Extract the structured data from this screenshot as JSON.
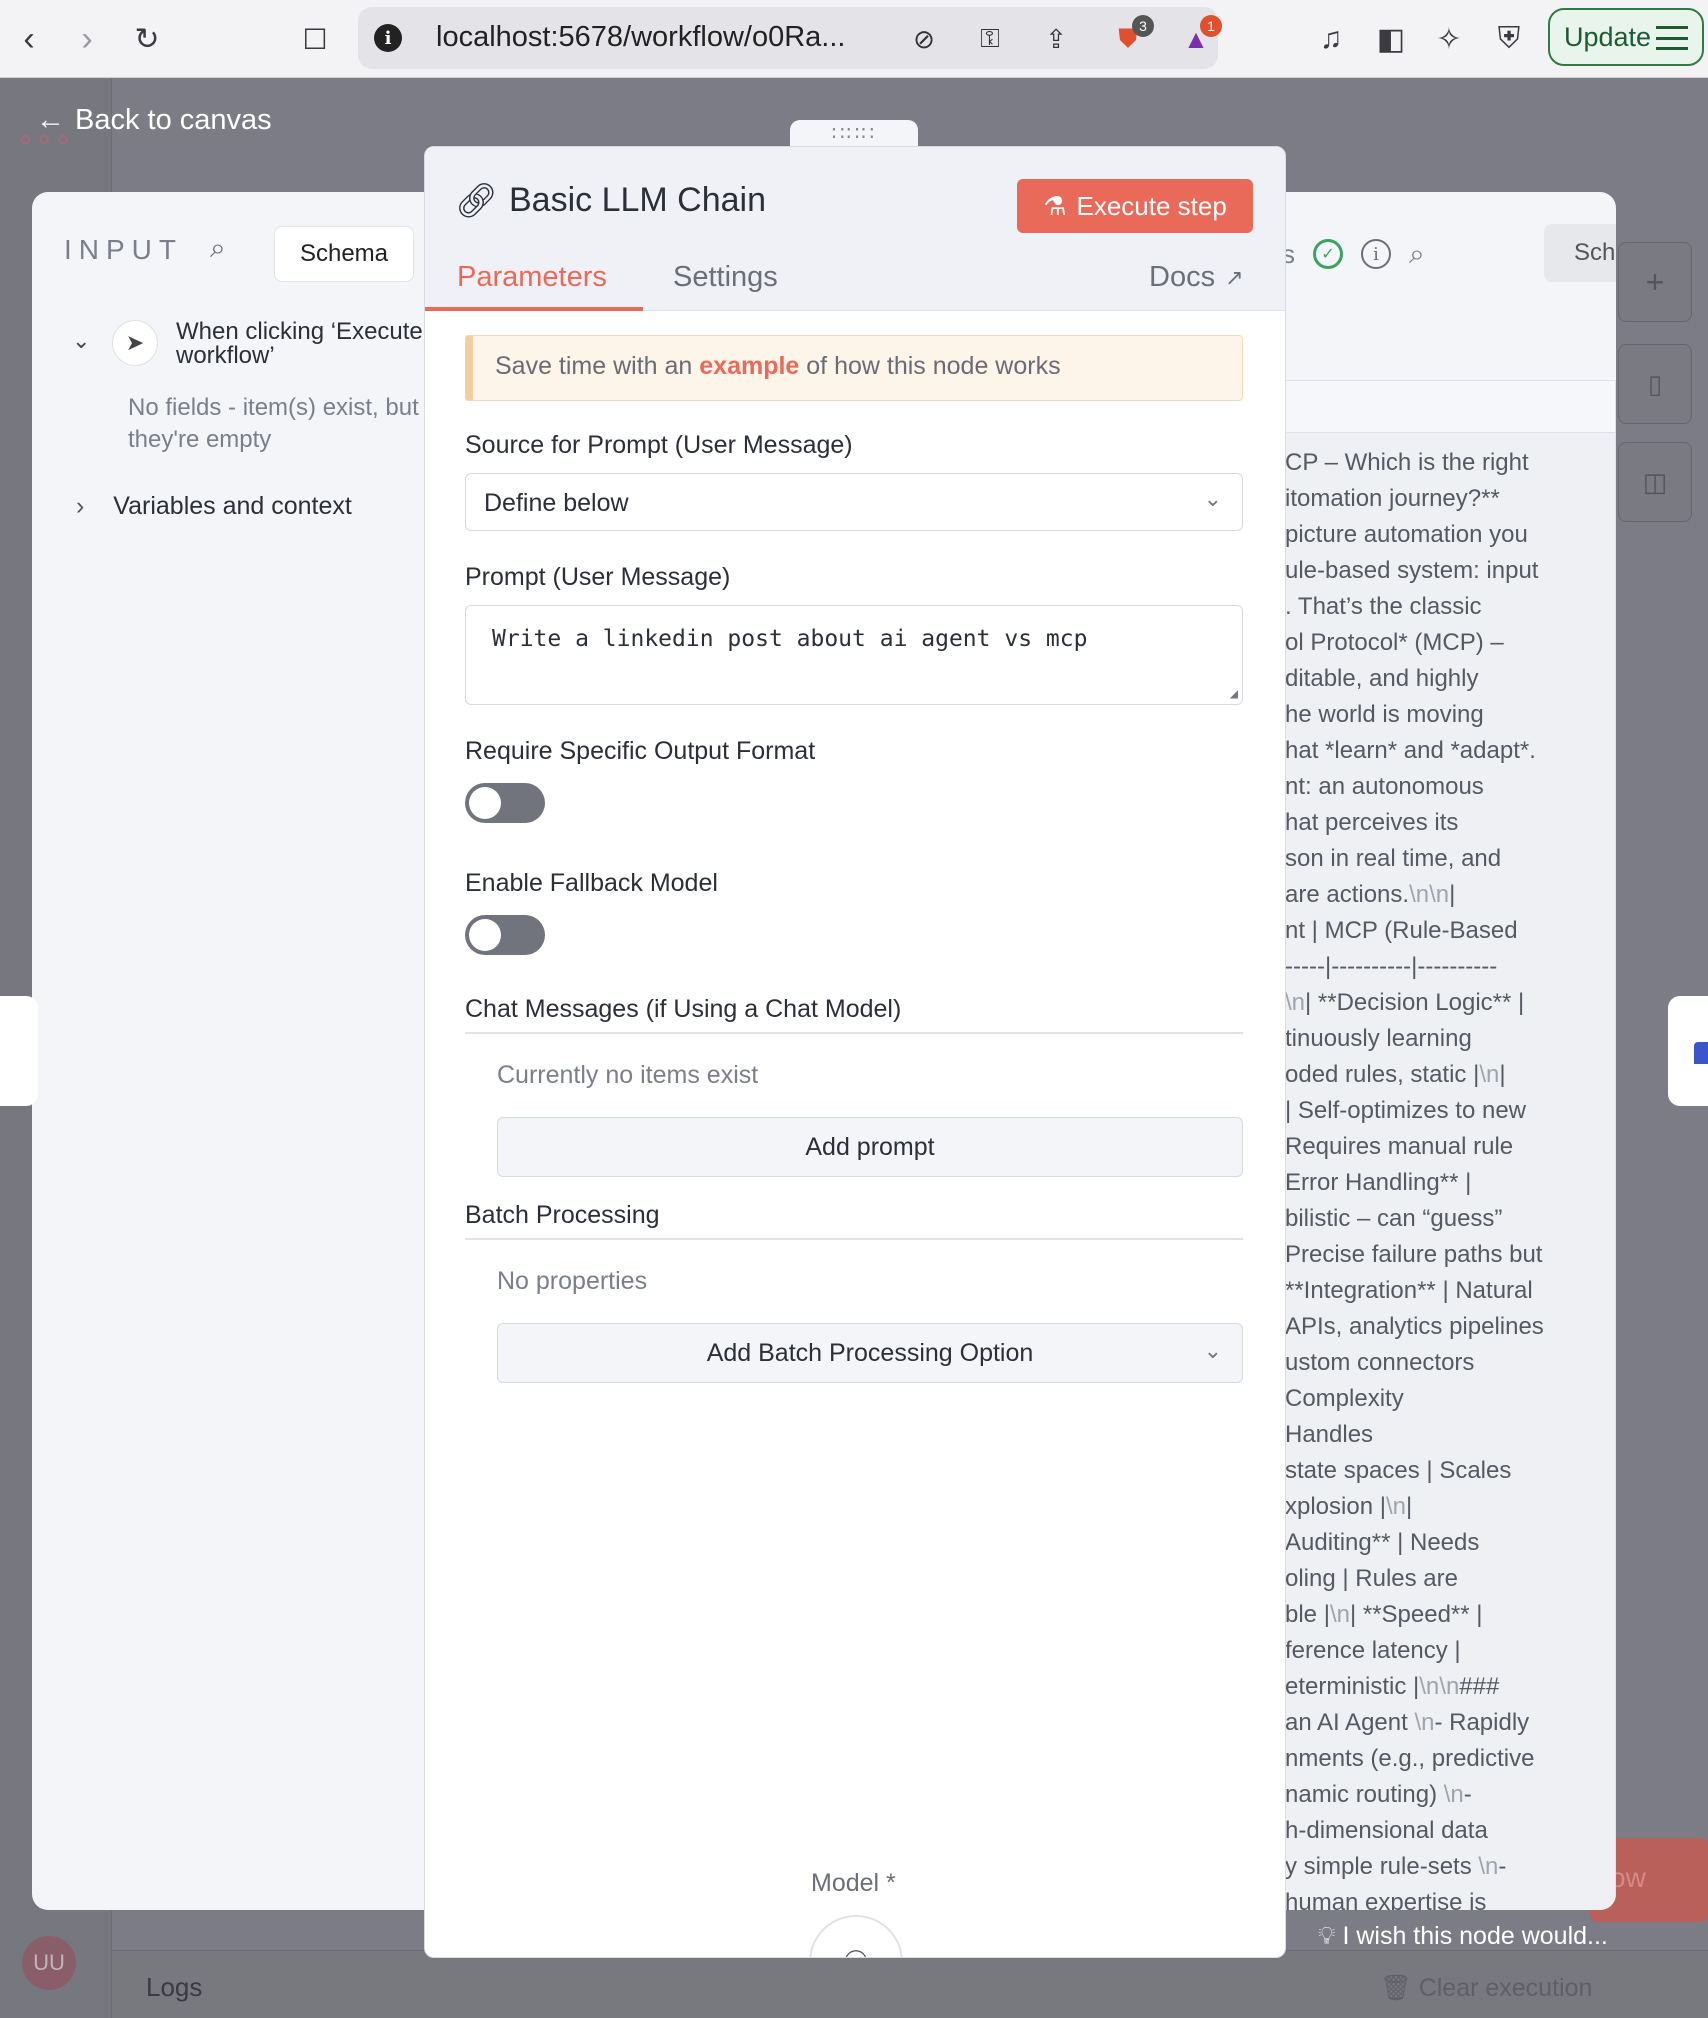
{
  "browser": {
    "url": "localhost:5678/workflow/o0Ra...",
    "brave_badge": "3",
    "rewards_badge": "1",
    "update_label": "Update"
  },
  "app": {
    "back_label": "Back to canvas",
    "avatar_initials": "UU",
    "logs_label": "Logs",
    "clear_execution_label": "Clear execution",
    "feedback_text": "I wish this node would...",
    "bg_button_text": "ow"
  },
  "input_panel": {
    "title": "INPUT",
    "schema_tab": "Schema",
    "trigger_name": "When clicking ‘Execute workflow’",
    "no_fields": "No fields - item(s) exist, but they're empty",
    "variables_label": "Variables and context"
  },
  "output_panel": {
    "header_partial": "s",
    "schema_tab": "Schem",
    "lines": [
      "CP – Which is the right",
      "itomation journey?**",
      "picture automation you",
      "ule-based system: input",
      ". That’s the classic",
      "ol Protocol* (MCP) –",
      "ditable, and highly",
      "he world is moving",
      "hat *learn* and *adapt*.",
      "nt: an autonomous",
      "hat perceives its",
      "son in real time, and",
      "are actions.\\n\\n|",
      "nt | MCP (Rule-Based",
      "-----|----------|----------",
      "\\n| **Decision Logic** |",
      "tinuously learning",
      "oded rules, static |\\n|",
      "| Self-optimizes to new",
      "Requires manual rule",
      "Error Handling** |",
      "bilistic – can “guess”",
      "Precise failure paths but",
      "**Integration** | Natural",
      "APIs, analytics pipelines",
      "ustom connectors",
      "Complexity",
      "Handles",
      "state spaces | Scales",
      "xplosion |\\n|",
      "Auditing** | Needs",
      "oling | Rules are",
      "ble |\\n| **Speed** |",
      "ference latency |",
      "eterministic |\\n\\n###",
      "an AI Agent \\n- Rapidly",
      "nments (e.g., predictive",
      "namic routing) \\n-",
      "h-dimensional data",
      "y simple rule-sets \\n-",
      "human expertise is"
    ]
  },
  "node": {
    "title": "Basic LLM Chain",
    "execute_label": "Execute step",
    "tabs": [
      "Parameters",
      "Settings"
    ],
    "docs_label": "Docs",
    "notice_pre": "Save time with an ",
    "notice_link": "example",
    "notice_post": " of how this node works",
    "source_label": "Source for Prompt (User Message)",
    "source_value": "Define below",
    "prompt_label": "Prompt (User Message)",
    "prompt_value": "Write a linkedin post about ai agent vs mcp",
    "require_format_label": "Require Specific Output Format",
    "require_format_on": false,
    "fallback_label": "Enable Fallback Model",
    "fallback_on": false,
    "chat_section": "Chat Messages (if Using a Chat Model)",
    "chat_empty": "Currently no items exist",
    "add_prompt_label": "Add prompt",
    "batch_section": "Batch Processing",
    "batch_empty": "No properties",
    "add_batch_label": "Add Batch Processing Option",
    "model_label": "Model *"
  },
  "colors": {
    "accent": "#ea6a5a",
    "success": "#3aa363",
    "overlay": "#7c7c86"
  }
}
